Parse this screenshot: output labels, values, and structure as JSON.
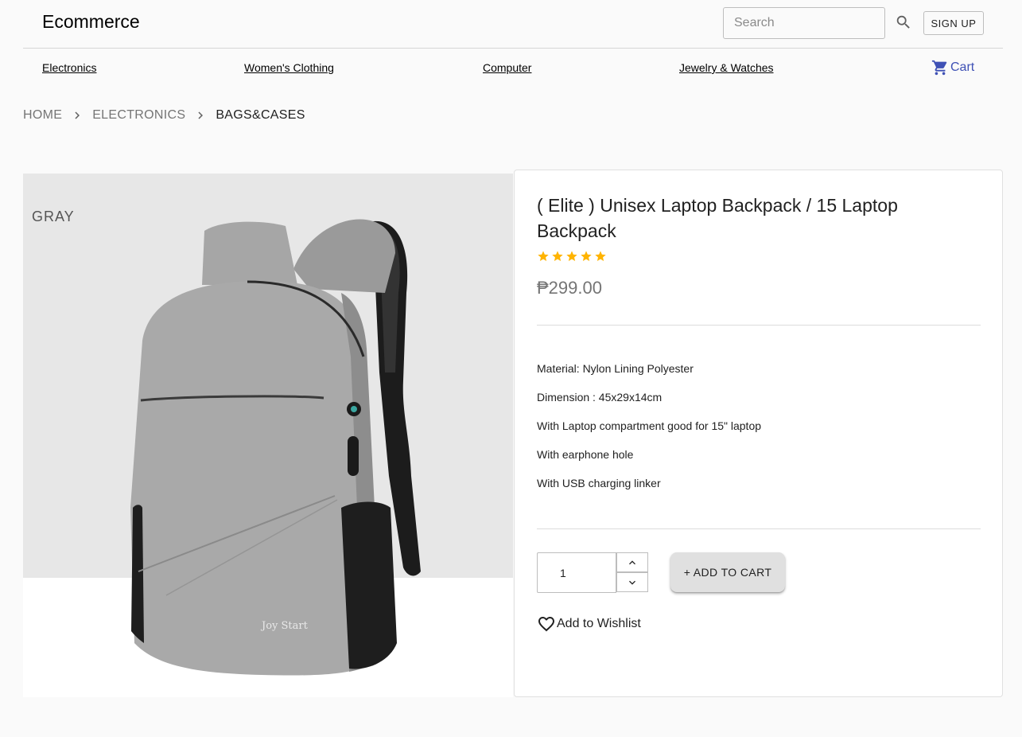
{
  "header": {
    "brand": "Ecommerce",
    "search_placeholder": "Search",
    "signup_label": "SIGN UP"
  },
  "nav": {
    "items": [
      "Electronics",
      "Women's Clothing",
      "Computer",
      "Jewelry & Watches"
    ],
    "cart_label": "Cart",
    "cart_color": "#3f51b5"
  },
  "breadcrumb": [
    "HOME",
    "ELECTRONICS",
    "BAGS&CASES"
  ],
  "product": {
    "image_label": "GRAY",
    "image_brand_text": "Joy Start",
    "title": "( Elite ) Unisex Laptop Backpack / 15 Laptop Backpack",
    "rating": 5,
    "rating_max": 5,
    "star_color": "#ffb400",
    "price": "₱299.00",
    "description": [
      "Material: Nylon Lining Polyester",
      "Dimension : 45x29x14cm",
      "With Laptop compartment good for 15\" laptop",
      "With earphone hole",
      "With USB charging linker"
    ],
    "quantity": "1",
    "add_to_cart_label": "+ ADD TO CART",
    "wishlist_label": "Add to Wishlist"
  },
  "icons": {
    "search": "search-icon",
    "cart": "cart-icon",
    "breadcrumb_separator": "chevron-right-icon",
    "star": "star-icon",
    "qty_up": "chevron-up-icon",
    "qty_down": "chevron-down-icon",
    "wishlist": "heart-outline-icon"
  }
}
